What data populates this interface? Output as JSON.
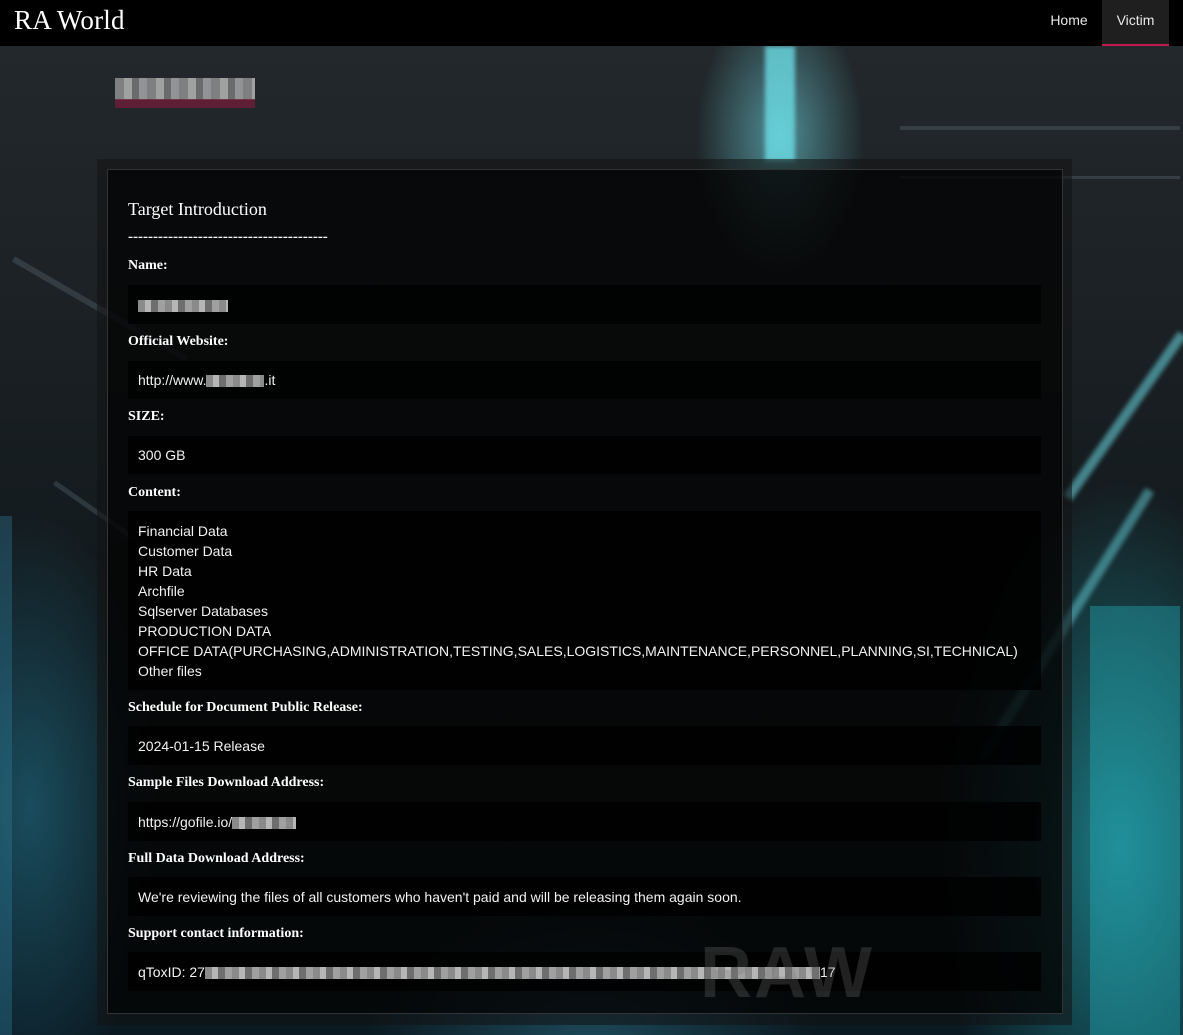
{
  "navbar": {
    "brand": "RA World",
    "links": [
      {
        "label": "Home",
        "active": false
      },
      {
        "label": "Victim",
        "active": true
      }
    ],
    "active_color": "#c2184e"
  },
  "victim_title": "",
  "section": {
    "title": "Target Introduction",
    "divider": "----------------------------------------"
  },
  "fields": {
    "name": {
      "label": "Name:",
      "value": ""
    },
    "website": {
      "label": "Official Website:",
      "prefix": "http://www.",
      "suffix": ".it"
    },
    "size": {
      "label": "SIZE:",
      "value": "300 GB"
    },
    "content": {
      "label": "Content:",
      "items": [
        "Financial Data",
        "Customer Data",
        "HR Data",
        "Archfile",
        "Sqlserver Databases",
        "PRODUCTION DATA",
        "OFFICE DATA(PURCHASING,ADMINISTRATION,TESTING,SALES,LOGISTICS,MAINTENANCE,PERSONNEL,PLANNING,SI,TECHNICAL)",
        "Other files"
      ]
    },
    "schedule": {
      "label": "Schedule for Document Public Release:",
      "value": "2024-01-15 Release"
    },
    "sample": {
      "label": "Sample Files Download Address:",
      "prefix": "https://gofile.io/"
    },
    "full": {
      "label": "Full Data Download Address:",
      "value": "We're reviewing the files of all customers who haven't paid and will be releasing them again soon."
    },
    "support": {
      "label": "Support contact information:",
      "prefix": "qToxID: 27",
      "suffix": "17"
    }
  },
  "background_watermark": "RAW"
}
